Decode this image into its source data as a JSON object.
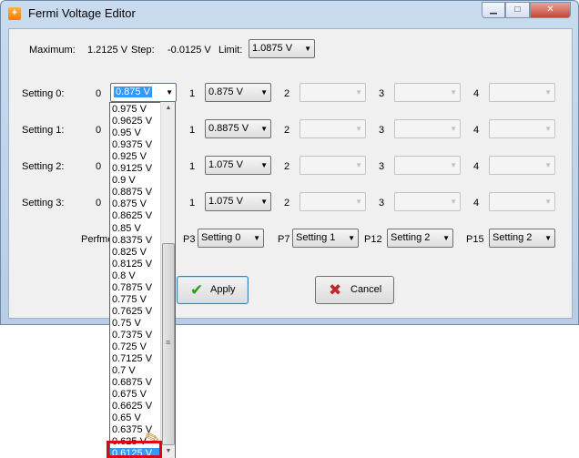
{
  "window": {
    "title": "Fermi Voltage Editor"
  },
  "summary": {
    "maximum_label": "Maximum:",
    "maximum_value": "1.2125 V",
    "step_label": "Step:",
    "step_value": "-0.0125 V",
    "limit_label": "Limit:",
    "limit_value": "1.0875 V"
  },
  "settings": [
    {
      "label": "Setting 0:",
      "idx0": "0",
      "idx1": "1",
      "idx2": "2",
      "idx3": "3",
      "idx4": "4",
      "val0": "0.875 V",
      "val1": "0.875 V"
    },
    {
      "label": "Setting 1:",
      "idx0": "0",
      "idx1": "1",
      "idx2": "2",
      "idx3": "3",
      "idx4": "4",
      "val1": "0.8875 V"
    },
    {
      "label": "Setting 2:",
      "idx0": "0",
      "idx1": "1",
      "idx2": "2",
      "idx3": "3",
      "idx4": "4",
      "val1": "1.075 V"
    },
    {
      "label": "Setting 3:",
      "idx0": "0",
      "idx1": "1",
      "idx2": "2",
      "idx3": "3",
      "idx4": "4",
      "val1": "1.075 V"
    }
  ],
  "perf": {
    "label_partial": "Perfmo",
    "p3_label": "P3",
    "p3_value": "Setting 0",
    "p7_label": "P7",
    "p7_value": "Setting 1",
    "p12_label": "P12",
    "p12_value": "Setting 2",
    "p15_label": "P15",
    "p15_value": "Setting 2"
  },
  "buttons": {
    "apply": "Apply",
    "cancel": "Cancel"
  },
  "dropdown": {
    "options": [
      "0.975 V",
      "0.9625 V",
      "0.95 V",
      "0.9375 V",
      "0.925 V",
      "0.9125 V",
      "0.9 V",
      "0.8875 V",
      "0.875 V",
      "0.8625 V",
      "0.85 V",
      "0.8375 V",
      "0.825 V",
      "0.8125 V",
      "0.8 V",
      "0.7875 V",
      "0.775 V",
      "0.7625 V",
      "0.75 V",
      "0.7375 V",
      "0.725 V",
      "0.7125 V",
      "0.7 V",
      "0.6875 V",
      "0.675 V",
      "0.6625 V",
      "0.65 V",
      "0.6375 V",
      "0.625 V",
      "0.6125 V"
    ],
    "selected_index": 29
  },
  "colors": {
    "selection": "#3399ff",
    "highlight_border": "#e0001b",
    "focus_border": "#3c7fb1"
  },
  "icons": {
    "app": "app-icon",
    "apply": "check-icon",
    "cancel": "x-icon",
    "cursor": "pen-cursor-icon"
  }
}
